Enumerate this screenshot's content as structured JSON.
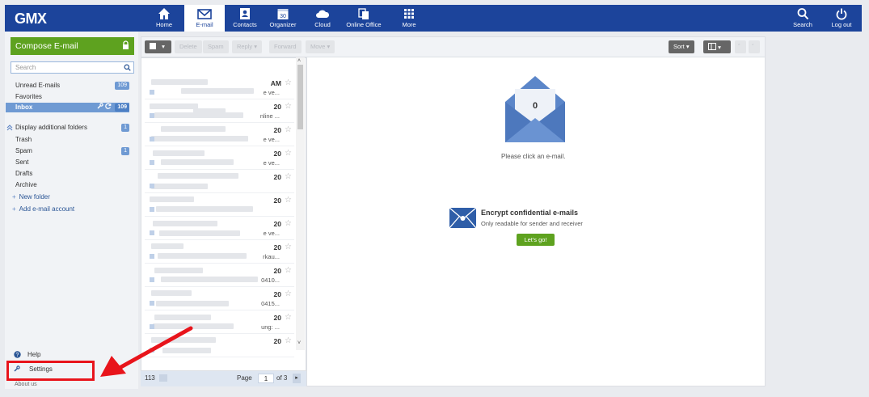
{
  "brand": {
    "logo": "GMX"
  },
  "nav": {
    "items": [
      {
        "label": "Home",
        "icon": "home-icon"
      },
      {
        "label": "E-mail",
        "icon": "mail-icon"
      },
      {
        "label": "Contacts",
        "icon": "contacts-icon"
      },
      {
        "label": "Organizer",
        "icon": "calendar-icon",
        "day": "30"
      },
      {
        "label": "Cloud",
        "icon": "cloud-icon"
      },
      {
        "label": "Online Office",
        "icon": "office-icon"
      },
      {
        "label": "More",
        "icon": "grid-icon"
      }
    ],
    "right": [
      {
        "label": "Search",
        "icon": "search-icon"
      },
      {
        "label": "Log out",
        "icon": "power-icon"
      }
    ]
  },
  "sidebar": {
    "compose_label": "Compose E-mail",
    "search_placeholder": "Search",
    "folders": [
      {
        "label": "Unread E-mails",
        "count": "109"
      },
      {
        "label": "Favorites",
        "count": ""
      },
      {
        "label": "Inbox",
        "count": "109",
        "active": true
      }
    ],
    "additional_label": "Display additional folders",
    "additional_count": "1",
    "extra_folders": [
      {
        "label": "Trash",
        "count": ""
      },
      {
        "label": "Spam",
        "count": "1"
      },
      {
        "label": "Sent",
        "count": ""
      },
      {
        "label": "Drafts",
        "count": ""
      },
      {
        "label": "Archive",
        "count": ""
      }
    ],
    "new_folder": "New folder",
    "add_account": "Add e-mail account",
    "help": "Help",
    "settings": "Settings",
    "about": "About us"
  },
  "toolbar": {
    "delete": "Delete",
    "spam": "Spam",
    "reply": "Reply",
    "forward": "Forward",
    "move": "Move",
    "sort": "Sort"
  },
  "list": {
    "rows": [
      {
        "time": "AM",
        "snippet": "e ve..."
      },
      {
        "time": "20",
        "snippet": "nline ..."
      },
      {
        "time": "20",
        "snippet": "e ve..."
      },
      {
        "time": "20",
        "snippet": "e ve..."
      },
      {
        "time": "20",
        "snippet": ""
      },
      {
        "time": "20",
        "snippet": ""
      },
      {
        "time": "20",
        "snippet": "e ve..."
      },
      {
        "time": "20",
        "snippet": "rkau..."
      },
      {
        "time": "20",
        "snippet": "0410..."
      },
      {
        "time": "20",
        "snippet": "0415..."
      },
      {
        "time": "20",
        "snippet": "ung: ..."
      },
      {
        "time": "20",
        "snippet": ""
      }
    ],
    "footer": {
      "total": "113",
      "page_label": "Page",
      "page": "1",
      "of": "of 3"
    }
  },
  "reader": {
    "unread_count": "0",
    "empty_text": "Please click an e-mail.",
    "promo_title": "Encrypt confidential e-mails",
    "promo_sub": "Only readable for sender and receiver",
    "promo_button": "Let's go!"
  },
  "colors": {
    "brand": "#1c449b",
    "accent_green": "#5ea21f",
    "annotation_red": "#e8141b"
  }
}
